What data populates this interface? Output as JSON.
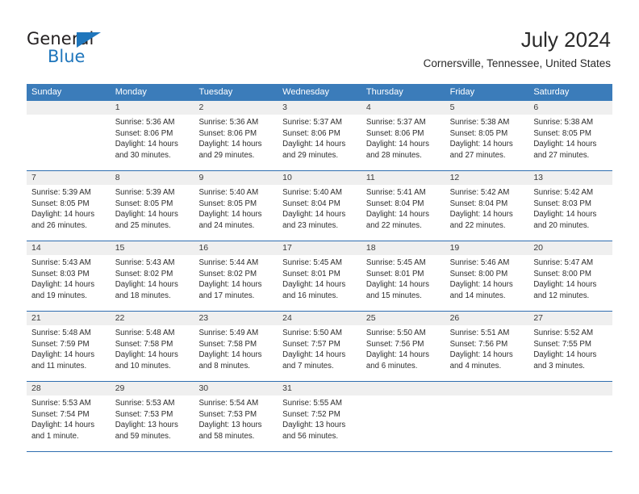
{
  "brand": {
    "name_top": "General",
    "name_bottom": "Blue",
    "triangle_color": "#1f76bc",
    "text_color": "#231f20",
    "blue_color": "#1f76bc"
  },
  "header": {
    "month_title": "July 2024",
    "location": "Cornersville, Tennessee, United States"
  },
  "theme": {
    "header_bg": "#3b7cba",
    "header_text": "#ffffff",
    "row_separator": "#2f6eb0",
    "daynum_band": "#efefef",
    "body_text": "#2d2d2d"
  },
  "calendar": {
    "weekday_headers": [
      "Sunday",
      "Monday",
      "Tuesday",
      "Wednesday",
      "Thursday",
      "Friday",
      "Saturday"
    ],
    "weeks": [
      {
        "days": [
          {
            "num": "",
            "lines": []
          },
          {
            "num": "1",
            "lines": [
              "Sunrise: 5:36 AM",
              "Sunset: 8:06 PM",
              "Daylight: 14 hours",
              "and 30 minutes."
            ]
          },
          {
            "num": "2",
            "lines": [
              "Sunrise: 5:36 AM",
              "Sunset: 8:06 PM",
              "Daylight: 14 hours",
              "and 29 minutes."
            ]
          },
          {
            "num": "3",
            "lines": [
              "Sunrise: 5:37 AM",
              "Sunset: 8:06 PM",
              "Daylight: 14 hours",
              "and 29 minutes."
            ]
          },
          {
            "num": "4",
            "lines": [
              "Sunrise: 5:37 AM",
              "Sunset: 8:06 PM",
              "Daylight: 14 hours",
              "and 28 minutes."
            ]
          },
          {
            "num": "5",
            "lines": [
              "Sunrise: 5:38 AM",
              "Sunset: 8:05 PM",
              "Daylight: 14 hours",
              "and 27 minutes."
            ]
          },
          {
            "num": "6",
            "lines": [
              "Sunrise: 5:38 AM",
              "Sunset: 8:05 PM",
              "Daylight: 14 hours",
              "and 27 minutes."
            ]
          }
        ]
      },
      {
        "days": [
          {
            "num": "7",
            "lines": [
              "Sunrise: 5:39 AM",
              "Sunset: 8:05 PM",
              "Daylight: 14 hours",
              "and 26 minutes."
            ]
          },
          {
            "num": "8",
            "lines": [
              "Sunrise: 5:39 AM",
              "Sunset: 8:05 PM",
              "Daylight: 14 hours",
              "and 25 minutes."
            ]
          },
          {
            "num": "9",
            "lines": [
              "Sunrise: 5:40 AM",
              "Sunset: 8:05 PM",
              "Daylight: 14 hours",
              "and 24 minutes."
            ]
          },
          {
            "num": "10",
            "lines": [
              "Sunrise: 5:40 AM",
              "Sunset: 8:04 PM",
              "Daylight: 14 hours",
              "and 23 minutes."
            ]
          },
          {
            "num": "11",
            "lines": [
              "Sunrise: 5:41 AM",
              "Sunset: 8:04 PM",
              "Daylight: 14 hours",
              "and 22 minutes."
            ]
          },
          {
            "num": "12",
            "lines": [
              "Sunrise: 5:42 AM",
              "Sunset: 8:04 PM",
              "Daylight: 14 hours",
              "and 22 minutes."
            ]
          },
          {
            "num": "13",
            "lines": [
              "Sunrise: 5:42 AM",
              "Sunset: 8:03 PM",
              "Daylight: 14 hours",
              "and 20 minutes."
            ]
          }
        ]
      },
      {
        "days": [
          {
            "num": "14",
            "lines": [
              "Sunrise: 5:43 AM",
              "Sunset: 8:03 PM",
              "Daylight: 14 hours",
              "and 19 minutes."
            ]
          },
          {
            "num": "15",
            "lines": [
              "Sunrise: 5:43 AM",
              "Sunset: 8:02 PM",
              "Daylight: 14 hours",
              "and 18 minutes."
            ]
          },
          {
            "num": "16",
            "lines": [
              "Sunrise: 5:44 AM",
              "Sunset: 8:02 PM",
              "Daylight: 14 hours",
              "and 17 minutes."
            ]
          },
          {
            "num": "17",
            "lines": [
              "Sunrise: 5:45 AM",
              "Sunset: 8:01 PM",
              "Daylight: 14 hours",
              "and 16 minutes."
            ]
          },
          {
            "num": "18",
            "lines": [
              "Sunrise: 5:45 AM",
              "Sunset: 8:01 PM",
              "Daylight: 14 hours",
              "and 15 minutes."
            ]
          },
          {
            "num": "19",
            "lines": [
              "Sunrise: 5:46 AM",
              "Sunset: 8:00 PM",
              "Daylight: 14 hours",
              "and 14 minutes."
            ]
          },
          {
            "num": "20",
            "lines": [
              "Sunrise: 5:47 AM",
              "Sunset: 8:00 PM",
              "Daylight: 14 hours",
              "and 12 minutes."
            ]
          }
        ]
      },
      {
        "days": [
          {
            "num": "21",
            "lines": [
              "Sunrise: 5:48 AM",
              "Sunset: 7:59 PM",
              "Daylight: 14 hours",
              "and 11 minutes."
            ]
          },
          {
            "num": "22",
            "lines": [
              "Sunrise: 5:48 AM",
              "Sunset: 7:58 PM",
              "Daylight: 14 hours",
              "and 10 minutes."
            ]
          },
          {
            "num": "23",
            "lines": [
              "Sunrise: 5:49 AM",
              "Sunset: 7:58 PM",
              "Daylight: 14 hours",
              "and 8 minutes."
            ]
          },
          {
            "num": "24",
            "lines": [
              "Sunrise: 5:50 AM",
              "Sunset: 7:57 PM",
              "Daylight: 14 hours",
              "and 7 minutes."
            ]
          },
          {
            "num": "25",
            "lines": [
              "Sunrise: 5:50 AM",
              "Sunset: 7:56 PM",
              "Daylight: 14 hours",
              "and 6 minutes."
            ]
          },
          {
            "num": "26",
            "lines": [
              "Sunrise: 5:51 AM",
              "Sunset: 7:56 PM",
              "Daylight: 14 hours",
              "and 4 minutes."
            ]
          },
          {
            "num": "27",
            "lines": [
              "Sunrise: 5:52 AM",
              "Sunset: 7:55 PM",
              "Daylight: 14 hours",
              "and 3 minutes."
            ]
          }
        ]
      },
      {
        "days": [
          {
            "num": "28",
            "lines": [
              "Sunrise: 5:53 AM",
              "Sunset: 7:54 PM",
              "Daylight: 14 hours",
              "and 1 minute."
            ]
          },
          {
            "num": "29",
            "lines": [
              "Sunrise: 5:53 AM",
              "Sunset: 7:53 PM",
              "Daylight: 13 hours",
              "and 59 minutes."
            ]
          },
          {
            "num": "30",
            "lines": [
              "Sunrise: 5:54 AM",
              "Sunset: 7:53 PM",
              "Daylight: 13 hours",
              "and 58 minutes."
            ]
          },
          {
            "num": "31",
            "lines": [
              "Sunrise: 5:55 AM",
              "Sunset: 7:52 PM",
              "Daylight: 13 hours",
              "and 56 minutes."
            ]
          },
          {
            "num": "",
            "lines": []
          },
          {
            "num": "",
            "lines": []
          },
          {
            "num": "",
            "lines": []
          }
        ]
      }
    ]
  }
}
